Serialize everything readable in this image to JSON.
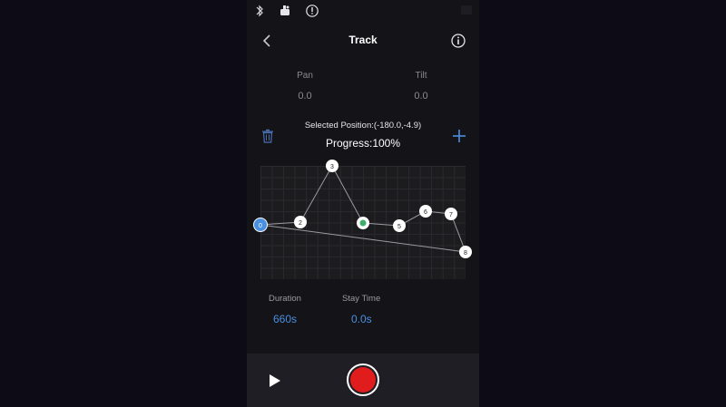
{
  "status_bar": {
    "icons": [
      "bluetooth-icon",
      "gimbal-icon",
      "info-circle-icon"
    ]
  },
  "nav": {
    "title": "Track",
    "back_icon": "chevron-left-icon",
    "info_icon": "info-icon"
  },
  "pan": {
    "label": "Pan",
    "value": "0.0"
  },
  "tilt": {
    "label": "Tilt",
    "value": "0.0"
  },
  "selected_position": "Selected Position:(-180.0,-4.9)",
  "progress": "Progress:100%",
  "track": {
    "points": [
      {
        "label": "0",
        "selected": true
      },
      {
        "label": "2"
      },
      {
        "label": "3"
      },
      {
        "label": ""
      },
      {
        "label": "5"
      },
      {
        "label": "6"
      },
      {
        "label": "7"
      },
      {
        "label": "8"
      }
    ]
  },
  "duration": {
    "label": "Duration",
    "value": "660s"
  },
  "stay_time": {
    "label": "Stay Time",
    "value": "0.0s"
  },
  "colors": {
    "accent": "#4a8fe0",
    "record": "#e01c1c",
    "background": "#141317",
    "point_green": "#3fae6a"
  }
}
